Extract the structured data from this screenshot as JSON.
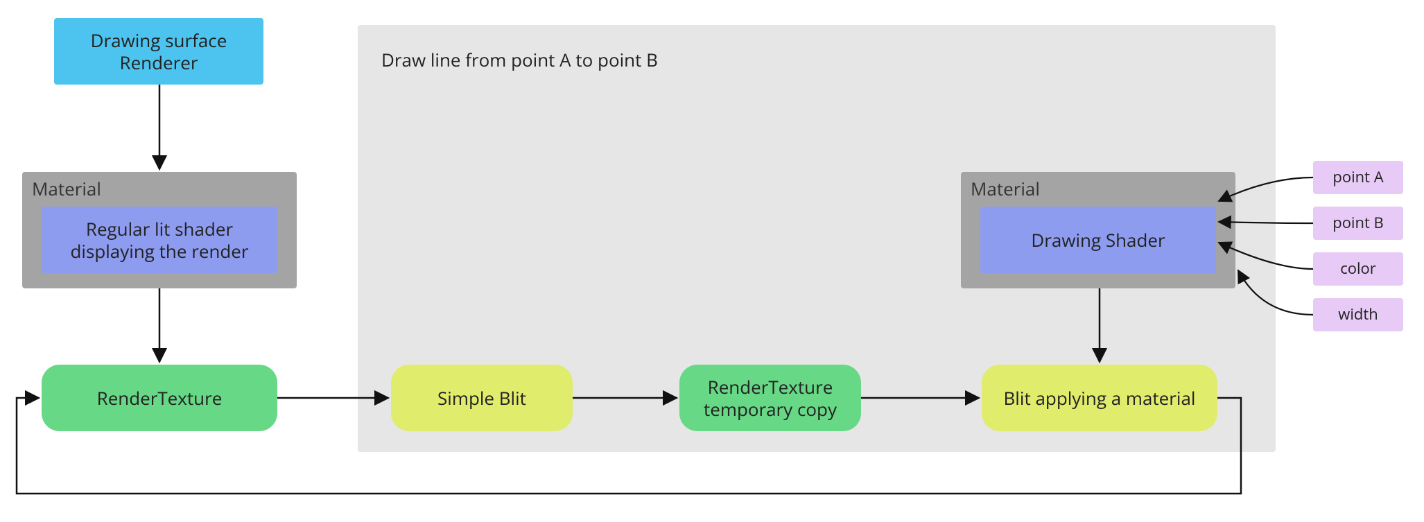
{
  "renderer_box": {
    "line1": "Drawing surface",
    "line2": "Renderer"
  },
  "material_left": {
    "label": "Material",
    "inner": "Regular lit shader\ndisplaying the render"
  },
  "render_texture": "RenderTexture",
  "panel_title": "Draw line from point A to point B",
  "simple_blit": "Simple Blit",
  "temp_copy": {
    "line1": "RenderTexture",
    "line2": "temporary copy"
  },
  "blit_material": "Blit applying a material",
  "material_right": {
    "label": "Material",
    "inner": "Drawing Shader"
  },
  "params": {
    "a": "point A",
    "b": "point B",
    "color": "color",
    "width": "width"
  }
}
